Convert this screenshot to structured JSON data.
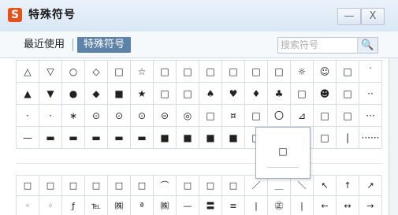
{
  "window": {
    "logo_letter": "S",
    "title": "特殊符号",
    "minimize_label": "—",
    "close_label": "X"
  },
  "tabs": [
    {
      "label": "最近使用"
    },
    {
      "label": "特殊符号"
    }
  ],
  "search": {
    "placeholder": "搜索符号",
    "icon": "search-icon",
    "icon_glyph": "🔍"
  },
  "grid_top": [
    [
      "△",
      "▽",
      "○",
      "◇",
      "□",
      "☆",
      "□",
      "□",
      "□",
      "□",
      "□",
      "□",
      "☼",
      "☺",
      "□",
      "˙"
    ],
    [
      "▲",
      "▼",
      "●",
      "◆",
      "■",
      "★",
      "□",
      "□",
      "♠",
      "♥",
      "♦",
      "♣",
      "□",
      "☻",
      "□",
      "··"
    ],
    [
      "·",
      "·",
      "∗",
      "⊙",
      "⊙",
      "⊙",
      "⊝",
      "◎",
      "□",
      "¤",
      "□",
      "〇",
      "⊿",
      "□",
      "□",
      "···"
    ],
    [
      "—",
      "▬",
      "▬",
      "▬",
      "▬",
      "▬",
      "■",
      "■",
      "■",
      "■",
      "□",
      "□",
      "□",
      "□",
      "|",
      "······"
    ]
  ],
  "grid_bottom": [
    [
      "□",
      "□",
      "□",
      "□",
      "□",
      "□",
      "⌒",
      "□",
      "□",
      "□",
      "／",
      "＿",
      "＼",
      "↖",
      "↑",
      "↗"
    ],
    [
      "◦",
      "◦",
      "ƒ",
      "℡",
      "㈱",
      "ª",
      "㈱",
      "—",
      "〓",
      "≡",
      "|",
      "㊣",
      "|",
      "←",
      "↔",
      "→"
    ]
  ],
  "preview": {
    "glyph": "□"
  },
  "colors": {
    "accent_tab": "#5e83aa",
    "logo": "#e8511b",
    "title_bar": "#dfeaf6"
  }
}
